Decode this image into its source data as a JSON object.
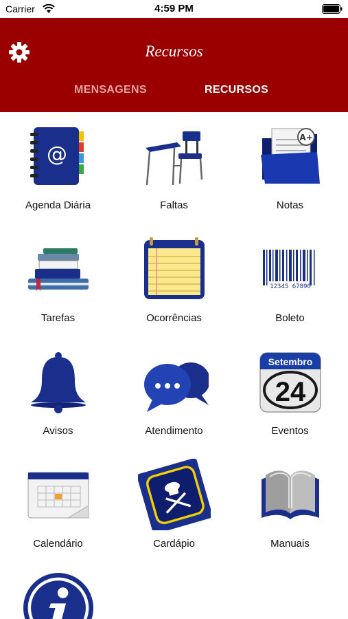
{
  "status_bar": {
    "carrier": "Carrier",
    "time": "4:59 PM"
  },
  "header": {
    "title": "Recursos",
    "tabs": [
      {
        "label": "MENSAGENS",
        "selected": false
      },
      {
        "label": "RECURSOS",
        "selected": true
      }
    ]
  },
  "colors": {
    "header": "#9b0000",
    "icon_blue": "#1a2e8c",
    "tab_inactive": "#e7a3a3"
  },
  "menu": {
    "agenda": "Agenda Diária",
    "faltas": "Faltas",
    "notas": "Notas",
    "tarefas": "Tarefas",
    "ocorrencias": "Ocorrências",
    "boleto": "Boleto",
    "avisos": "Avisos",
    "atendimento": "Atendimento",
    "eventos": "Eventos",
    "calendario": "Calendário",
    "cardapio": "Cardápio",
    "manuais": "Manuais"
  },
  "icon_text": {
    "boleto_number": "12345 67890",
    "event_month": "Setembro",
    "event_day": "24",
    "grade": "A+"
  }
}
